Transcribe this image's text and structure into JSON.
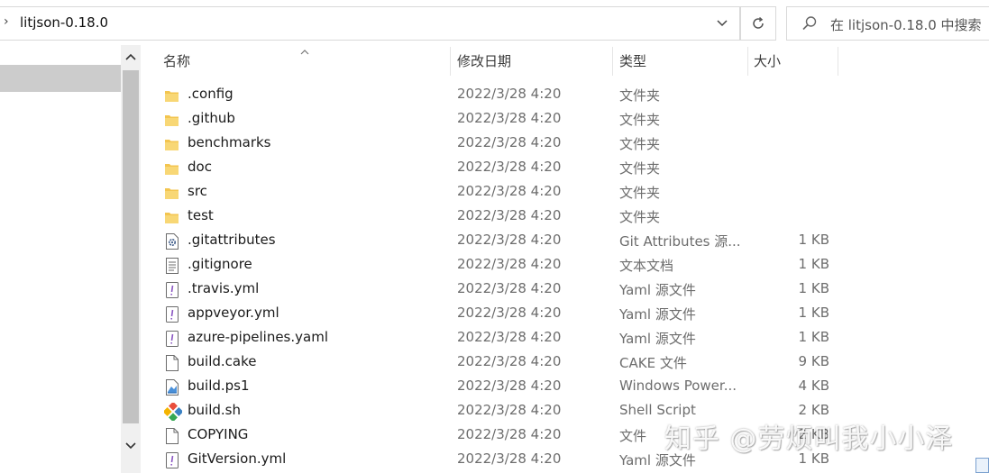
{
  "address": {
    "chevron": "›",
    "path": "litjson-0.18.0"
  },
  "search": {
    "placeholder": "在 litjson-0.18.0 中搜索"
  },
  "columns": {
    "name": "名称",
    "date": "修改日期",
    "type": "类型",
    "size": "大小"
  },
  "files": [
    {
      "icon": "folder-icon",
      "name": ".config",
      "date": "2022/3/28 4:20",
      "type": "文件夹",
      "size": ""
    },
    {
      "icon": "folder-icon",
      "name": ".github",
      "date": "2022/3/28 4:20",
      "type": "文件夹",
      "size": ""
    },
    {
      "icon": "folder-icon",
      "name": "benchmarks",
      "date": "2022/3/28 4:20",
      "type": "文件夹",
      "size": ""
    },
    {
      "icon": "folder-icon",
      "name": "doc",
      "date": "2022/3/28 4:20",
      "type": "文件夹",
      "size": ""
    },
    {
      "icon": "folder-icon",
      "name": "src",
      "date": "2022/3/28 4:20",
      "type": "文件夹",
      "size": ""
    },
    {
      "icon": "folder-icon",
      "name": "test",
      "date": "2022/3/28 4:20",
      "type": "文件夹",
      "size": ""
    },
    {
      "icon": "gear-file-icon",
      "name": ".gitattributes",
      "date": "2022/3/28 4:20",
      "type": "Git Attributes 源...",
      "size": "1 KB"
    },
    {
      "icon": "text-file-icon",
      "name": ".gitignore",
      "date": "2022/3/28 4:20",
      "type": "文本文档",
      "size": "1 KB"
    },
    {
      "icon": "yaml-file-icon",
      "name": ".travis.yml",
      "date": "2022/3/28 4:20",
      "type": "Yaml 源文件",
      "size": "1 KB"
    },
    {
      "icon": "yaml-file-icon",
      "name": "appveyor.yml",
      "date": "2022/3/28 4:20",
      "type": "Yaml 源文件",
      "size": "1 KB"
    },
    {
      "icon": "yaml-file-icon",
      "name": "azure-pipelines.yaml",
      "date": "2022/3/28 4:20",
      "type": "Yaml 源文件",
      "size": "1 KB"
    },
    {
      "icon": "blank-file-icon",
      "name": "build.cake",
      "date": "2022/3/28 4:20",
      "type": "CAKE 文件",
      "size": "9 KB"
    },
    {
      "icon": "powershell-file-icon",
      "name": "build.ps1",
      "date": "2022/3/28 4:20",
      "type": "Windows Power...",
      "size": "4 KB"
    },
    {
      "icon": "git-shell-icon",
      "name": "build.sh",
      "date": "2022/3/28 4:20",
      "type": "Shell Script",
      "size": "2 KB"
    },
    {
      "icon": "blank-file-icon",
      "name": "COPYING",
      "date": "2022/3/28 4:20",
      "type": "文件",
      "size": "2 KB"
    },
    {
      "icon": "yaml-file-icon",
      "name": "GitVersion.yml",
      "date": "2022/3/28 4:20",
      "type": "Yaml 源文件",
      "size": "1 KB"
    }
  ],
  "watermark": "知乎 @劳烦叫我小小泽",
  "colors": {
    "folder": "#f3c550",
    "nav_selected": "#cccccc",
    "scrollbar_thumb": "#c2c2c2"
  }
}
